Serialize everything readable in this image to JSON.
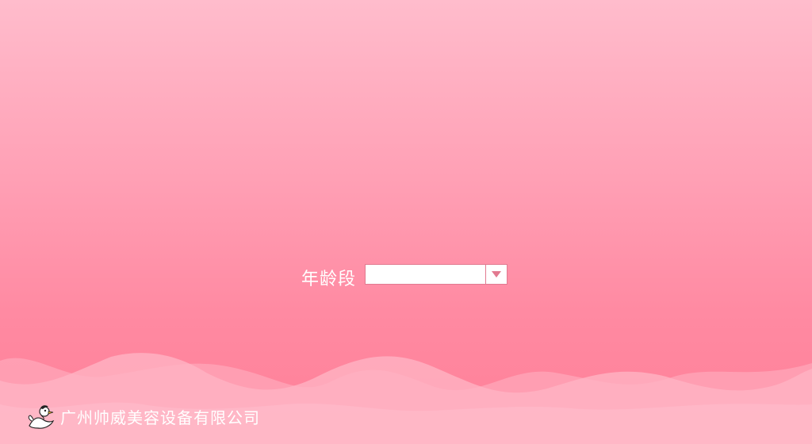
{
  "form": {
    "age_group_label": "年龄段",
    "age_group_select": {
      "selected_value": ""
    }
  },
  "footer": {
    "logo_icon": "duck-mascot-icon",
    "company_name": "广州帅威美容设备有限公司"
  },
  "colors": {
    "background_top": "#ffbccc",
    "background_bottom": "#ff7f97",
    "accent": "#e27a90",
    "text": "#ffffff"
  }
}
